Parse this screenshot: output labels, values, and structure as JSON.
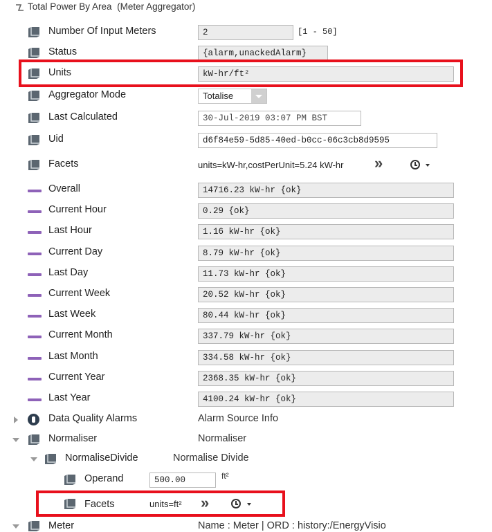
{
  "header": {
    "title": "Total Power By Area",
    "subtitle": "(Meter Aggregator)"
  },
  "properties": {
    "num_input_meters": {
      "label": "Number Of Input Meters",
      "value": "2",
      "range": "[1 - 50]"
    },
    "status": {
      "label": "Status",
      "value": "{alarm,unackedAlarm}"
    },
    "units": {
      "label": "Units",
      "value": "kW-hr/ft²"
    },
    "aggregator_mode": {
      "label": "Aggregator Mode",
      "value": "Totalise"
    },
    "last_calculated": {
      "label": "Last Calculated",
      "value": "30-Jul-2019 03:07 PM BST"
    },
    "uid": {
      "label": "Uid",
      "value": "d6f84e59-5d85-40ed-b0cc-06c3cb8d9595"
    },
    "facets": {
      "label": "Facets",
      "value": "units=kW-hr,costPerUnit=5.24 kW-hr"
    }
  },
  "values": [
    {
      "label": "Overall",
      "value": "14716.23 kW-hr {ok}"
    },
    {
      "label": "Current Hour",
      "value": "0.29 {ok}"
    },
    {
      "label": "Last Hour",
      "value": "1.16 kW-hr {ok}"
    },
    {
      "label": "Current Day",
      "value": "8.79 kW-hr {ok}"
    },
    {
      "label": "Last Day",
      "value": "11.73 kW-hr {ok}"
    },
    {
      "label": "Current Week",
      "value": "20.52 kW-hr {ok}"
    },
    {
      "label": "Last Week",
      "value": "80.44 kW-hr {ok}"
    },
    {
      "label": "Current Month",
      "value": "337.79 kW-hr {ok}"
    },
    {
      "label": "Last Month",
      "value": "334.58 kW-hr {ok}"
    },
    {
      "label": "Current Year",
      "value": "2368.35 kW-hr {ok}"
    },
    {
      "label": "Last Year",
      "value": "4100.24 kW-hr {ok}"
    }
  ],
  "tree": {
    "data_quality": {
      "label": "Data Quality Alarms",
      "value": "Alarm Source Info"
    },
    "normaliser": {
      "label": "Normaliser",
      "value": "Normaliser"
    },
    "normalise_divide": {
      "label": "NormaliseDivide",
      "value": "Normalise Divide"
    },
    "operand": {
      "label": "Operand",
      "value": "500.00",
      "unit": "ft²"
    },
    "sub_facets": {
      "label": "Facets",
      "value": "units=ft²"
    },
    "meter": {
      "label": "Meter",
      "value": "Name : Meter | ORD : history:/EnergyVisio"
    }
  },
  "colors": {
    "highlight": "#e8101c",
    "value_line": "#8e62b8"
  },
  "icons": {
    "chevrons": "»",
    "clock": "clock-icon"
  }
}
